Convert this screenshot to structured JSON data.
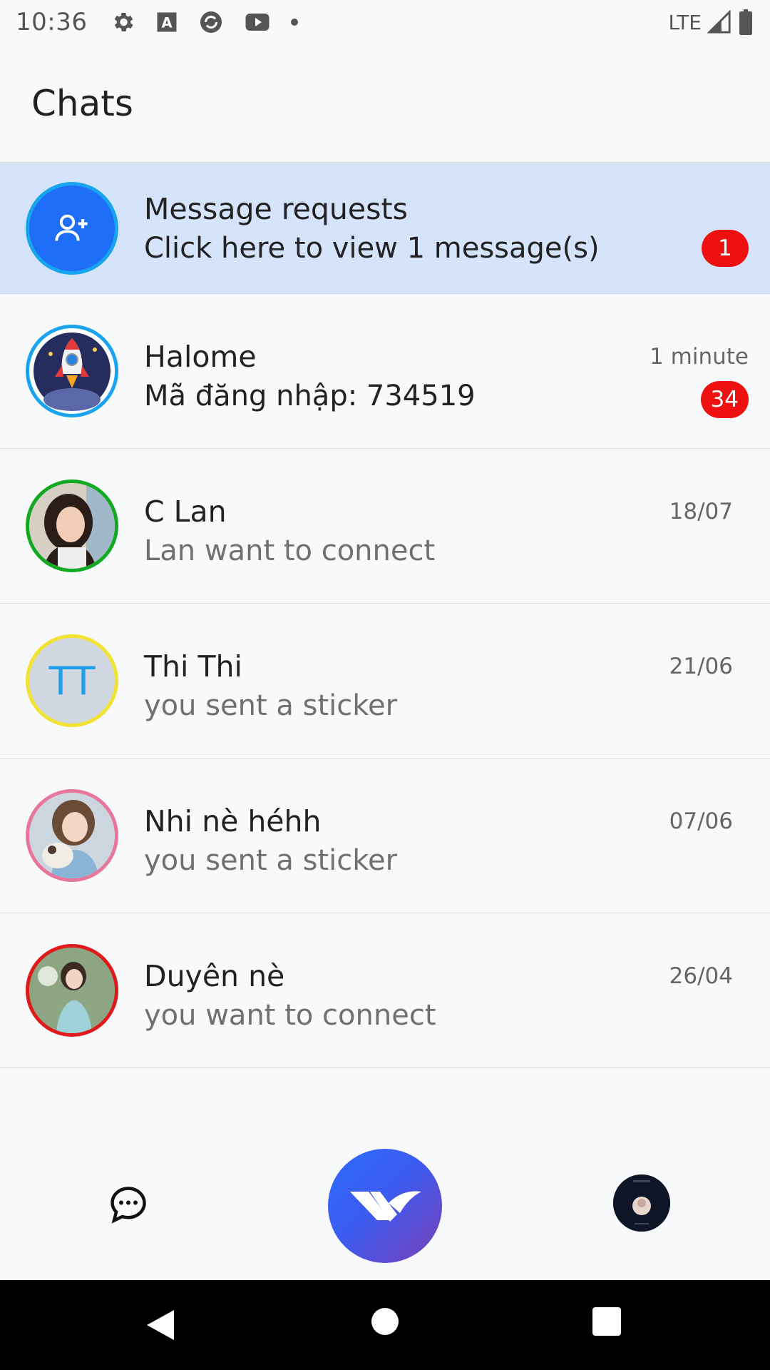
{
  "status_bar": {
    "time": "10:36",
    "icons": [
      "gear-icon",
      "a-box-icon",
      "sync-icon",
      "youtube-icon",
      "dot-icon"
    ],
    "network": "LTE",
    "right_icons": [
      "signal-icon",
      "battery-icon"
    ]
  },
  "header": {
    "title": "Chats"
  },
  "message_requests": {
    "title": "Message requests",
    "subtitle": "Click here to view 1 message(s)",
    "badge": "1",
    "icon": "person-add-icon",
    "color": "#1e6ef7"
  },
  "chats": [
    {
      "name": "Halome",
      "message": "Mã đăng nhập: 734519",
      "time": "1 minute",
      "badge": "34",
      "ring_color": "#1aa3ee",
      "avatar": "rocket"
    },
    {
      "name": "C Lan",
      "message": "Lan want to connect",
      "time": "18/07",
      "badge": "",
      "ring_color": "#11aa22",
      "avatar": "photo"
    },
    {
      "name": "Thi Thi",
      "message": "you sent a sticker",
      "time": "21/06",
      "badge": "",
      "ring_color": "#f2e233",
      "avatar": "initials",
      "initials": "TT"
    },
    {
      "name": "Nhi nè héhh",
      "message": "you sent a sticker",
      "time": "07/06",
      "badge": "",
      "ring_color": "#e8759b",
      "avatar": "photo"
    },
    {
      "name": "Duyên nè",
      "message": "you want to connect",
      "time": "26/04",
      "badge": "",
      "ring_color": "#e01a1a",
      "avatar": "photo"
    }
  ],
  "bottom_nav": {
    "items": [
      "chat-bubble-icon",
      "app-logo-icon",
      "profile-avatar"
    ]
  },
  "system_nav": [
    "back-icon",
    "home-icon",
    "recents-icon"
  ]
}
